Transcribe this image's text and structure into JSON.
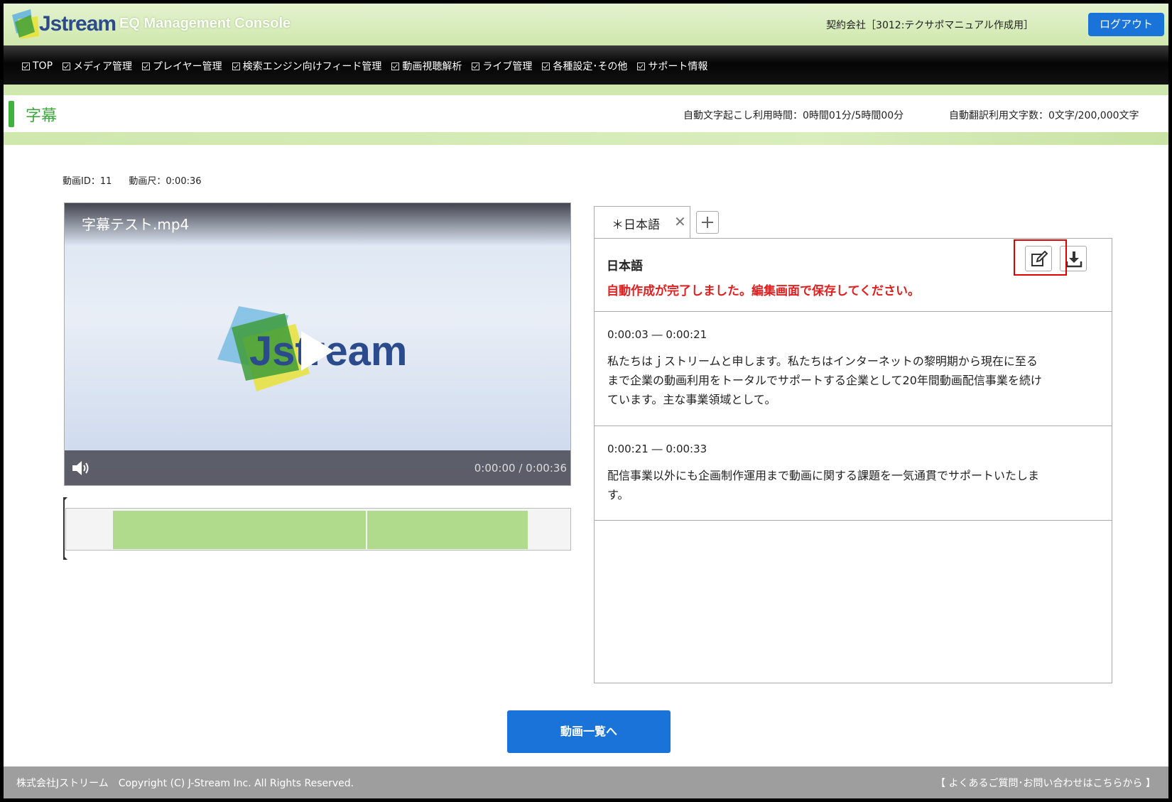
{
  "header": {
    "logo_text": "Jstream",
    "console_title": "EQ Management Console",
    "company": "契約会社［3012:テクサポマニュアル作成用］",
    "logout_label": "ログアウト"
  },
  "nav": {
    "items": [
      {
        "label": "TOP"
      },
      {
        "label": "メディア管理"
      },
      {
        "label": "プレイヤー管理"
      },
      {
        "label": "検索エンジン向けフィード管理"
      },
      {
        "label": "動画視聴解析"
      },
      {
        "label": "ライブ管理"
      },
      {
        "label": "各種設定･その他"
      },
      {
        "label": "サポート情報"
      }
    ]
  },
  "page": {
    "title": "字幕",
    "auto_transcription_usage": "自動文字起こし利用時間：0時間01分/5時間00分",
    "auto_translation_usage": "自動翻訳利用文字数：0文字/200,000文字"
  },
  "video": {
    "id_label": "動画ID：11",
    "duration_label": "動画尺：0:00:36",
    "filename": "字幕テスト.mp4",
    "time_display": "0:00:00 / 0:00:36",
    "logo_text": "Jstream",
    "playback_progress": 0
  },
  "subtitles": {
    "tab_label": "＊日本語",
    "tab_close": "✕",
    "language": "日本語",
    "status_message": "自動作成が完了しました。編集画面で保存してください。",
    "cues": [
      {
        "time": "0:00:03 ― 0:00:21",
        "text": "私たちはｊストリームと申します。私たちはインターネットの黎明期から現在に至るまで企業の動画利用をトータルでサポートする企業として20年間動画配信事業を続けています。主な事業領域として。"
      },
      {
        "time": "0:00:21 ― 0:00:33",
        "text": "配信事業以外にも企画制作運用まで動画に関する課題を一気通貫でサポートいたします。"
      }
    ]
  },
  "actions": {
    "back_to_list_label": "動画一覧へ"
  },
  "footer": {
    "copyright": "株式会社Jストリーム　Copyright (C) J-Stream Inc. All Rights Reserved.",
    "help_link": "【 よくあるご質問･お問い合わせはこちらから 】"
  },
  "colors": {
    "accent_green": "#3fa83f",
    "header_green": "#cfe8ad",
    "primary_blue": "#1a73d9",
    "error_red": "#e02020",
    "timeline_segment": "#b0db8c"
  }
}
